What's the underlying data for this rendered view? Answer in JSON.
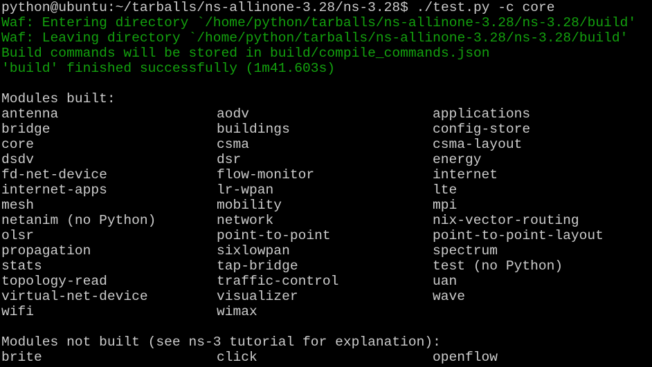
{
  "terminal": {
    "prompt_line": "python@ubuntu:~/tarballs/ns-allinone-3.28/ns-3.28$ ./test.py -c core",
    "waf_lines": [
      "Waf: Entering directory `/home/python/tarballs/ns-allinone-3.28/ns-3.28/build'",
      "Waf: Leaving directory `/home/python/tarballs/ns-allinone-3.28/ns-3.28/build'",
      "Build commands will be stored in build/compile_commands.json",
      "'build' finished successfully (1m41.603s)"
    ],
    "modules_built_header": "Modules built:",
    "modules_built": [
      [
        "antenna",
        "aodv",
        "applications"
      ],
      [
        "bridge",
        "buildings",
        "config-store"
      ],
      [
        "core",
        "csma",
        "csma-layout"
      ],
      [
        "dsdv",
        "dsr",
        "energy"
      ],
      [
        "fd-net-device",
        "flow-monitor",
        "internet"
      ],
      [
        "internet-apps",
        "lr-wpan",
        "lte"
      ],
      [
        "mesh",
        "mobility",
        "mpi"
      ],
      [
        "netanim (no Python)",
        "network",
        "nix-vector-routing"
      ],
      [
        "olsr",
        "point-to-point",
        "point-to-point-layout"
      ],
      [
        "propagation",
        "sixlowpan",
        "spectrum"
      ],
      [
        "stats",
        "tap-bridge",
        "test (no Python)"
      ],
      [
        "topology-read",
        "traffic-control",
        "uan"
      ],
      [
        "virtual-net-device",
        "visualizer",
        "wave"
      ],
      [
        "wifi",
        "wimax",
        ""
      ]
    ],
    "modules_not_built_header": "Modules not built (see ns-3 tutorial for explanation):",
    "modules_not_built": [
      [
        "brite",
        "click",
        "openflow"
      ]
    ],
    "colors": {
      "background": "#000000",
      "text": "#cccccc",
      "success": "#13a10e"
    }
  }
}
